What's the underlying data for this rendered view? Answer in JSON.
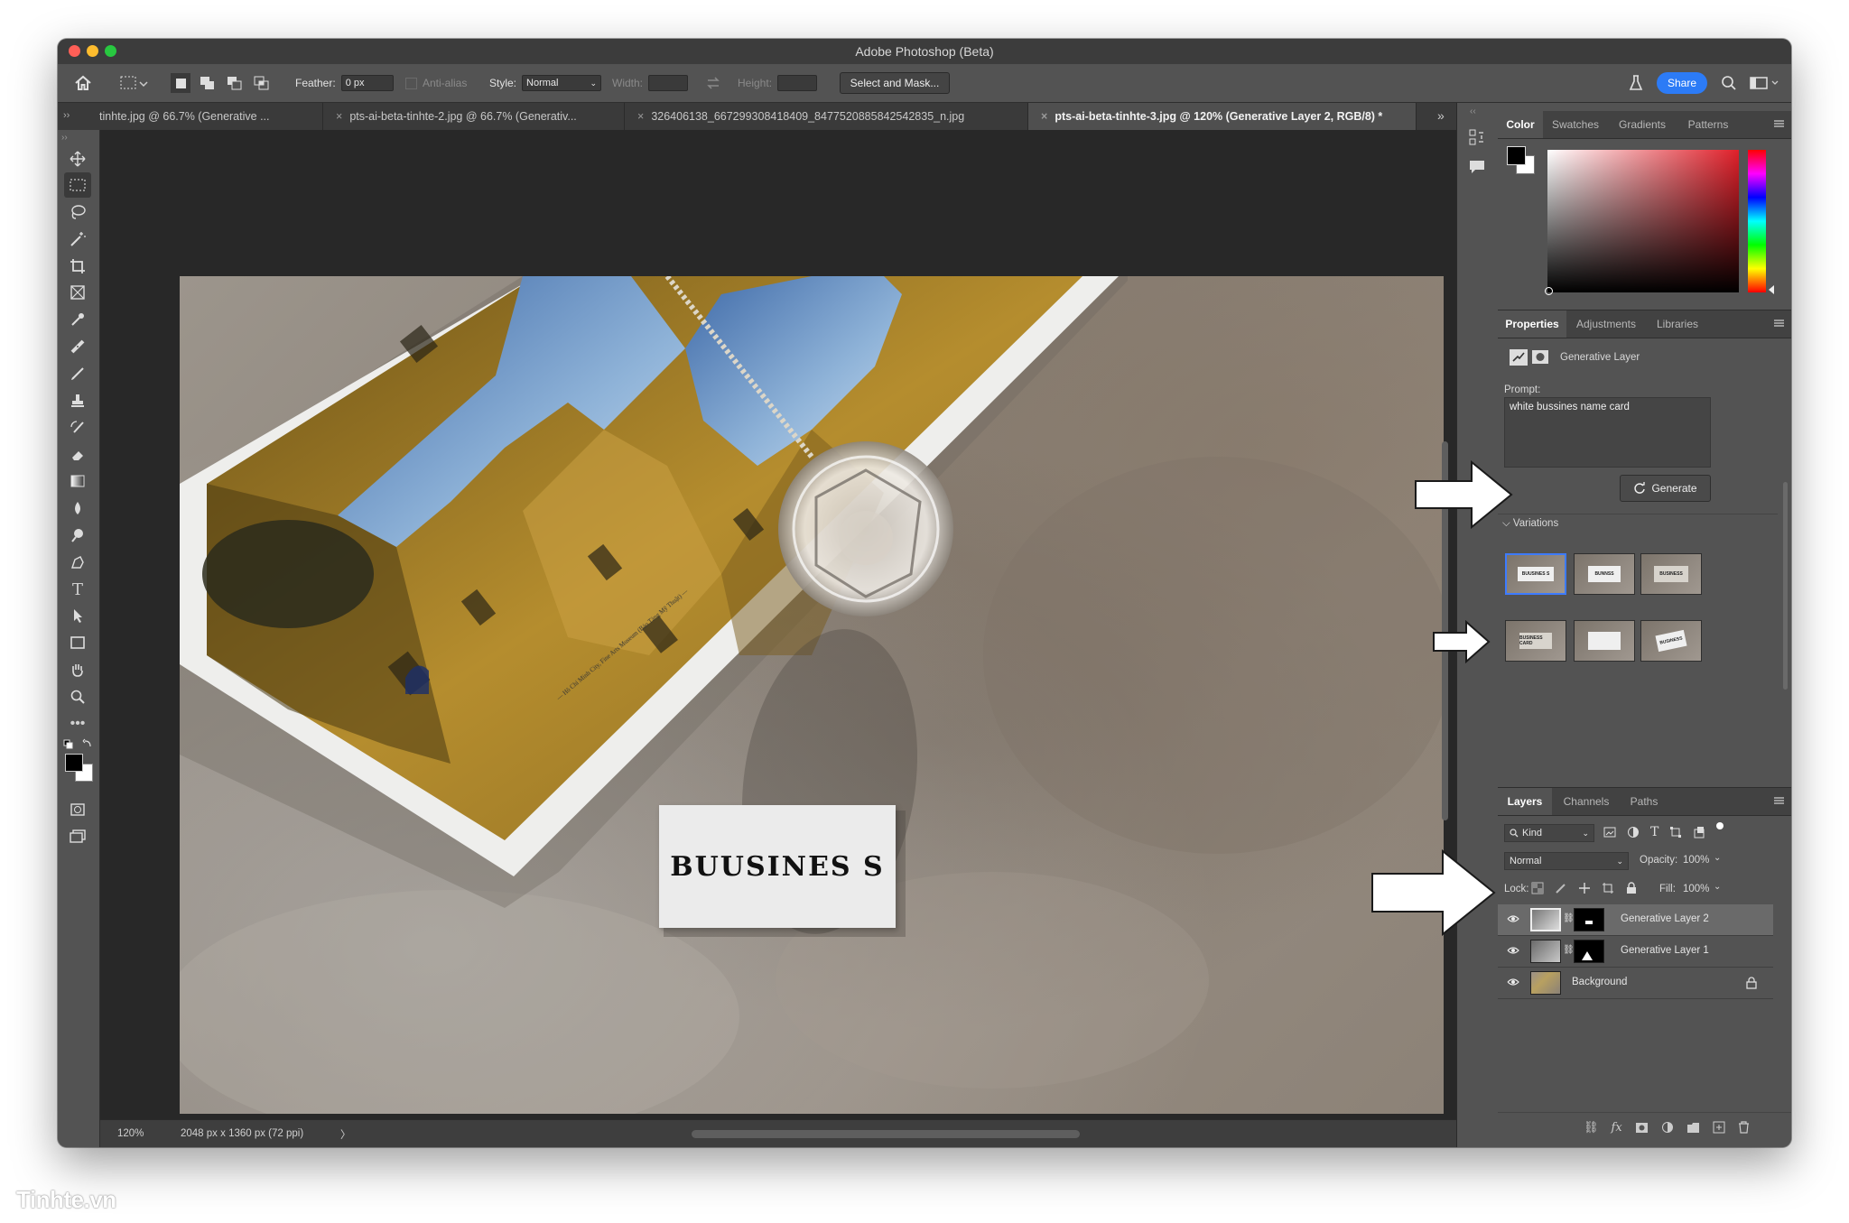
{
  "app": {
    "title": "Adobe Photoshop (Beta)"
  },
  "options_bar": {
    "feather_label": "Feather:",
    "feather_value": "0 px",
    "anti_alias_label": "Anti-alias",
    "style_label": "Style:",
    "style_value": "Normal",
    "width_label": "Width:",
    "height_label": "Height:",
    "select_mask_label": "Select and Mask...",
    "share_label": "Share"
  },
  "tabs": [
    {
      "label": "tinhte.jpg @ 66.7% (Generative ..."
    },
    {
      "label": "pts-ai-beta-tinhte-2.jpg @ 66.7% (Generativ..."
    },
    {
      "label": "326406138_667299308418409_8477520885842542835_n.jpg"
    },
    {
      "label": "pts-ai-beta-tinhte-3.jpg @ 120% (Generative Layer 2, RGB/8) *"
    }
  ],
  "canvas": {
    "card_text": "BUUSINES S",
    "magazine_caption": "— Hô Chí Minh City, Fine Arts Museum (Bảo Tàng Mỹ Thuật) —"
  },
  "status": {
    "zoom": "120%",
    "doc_info": "2048 px x 1360 px (72 ppi)",
    "chevron": "〉"
  },
  "color_panel": {
    "tabs": [
      "Color",
      "Swatches",
      "Gradients",
      "Patterns"
    ]
  },
  "properties_panel": {
    "tabs": [
      "Properties",
      "Adjustments",
      "Libraries"
    ],
    "layer_type": "Generative Layer",
    "prompt_label": "Prompt:",
    "prompt_value": "white bussines name card",
    "generate_label": "Generate",
    "variations_label": "Variations",
    "variations": [
      "BUUSINES S",
      "BUNNSS",
      "BUSINESS",
      "BUSINESS CARD",
      "",
      "BUSINESS"
    ]
  },
  "layers_panel": {
    "tabs": [
      "Layers",
      "Channels",
      "Paths"
    ],
    "kind_label": "Kind",
    "blend_mode": "Normal",
    "opacity_label": "Opacity:",
    "opacity_value": "100%",
    "lock_label": "Lock:",
    "fill_label": "Fill:",
    "fill_value": "100%",
    "layers": [
      {
        "name": "Generative Layer 2",
        "selected": true
      },
      {
        "name": "Generative Layer 1",
        "selected": false
      },
      {
        "name": "Background",
        "selected": false
      }
    ],
    "footer_fx": "fx"
  },
  "watermark": "Tinhte.vn",
  "colors": {
    "accent": "#2c7bf6",
    "panel": "#535353",
    "canvas_bg": "#282828"
  }
}
